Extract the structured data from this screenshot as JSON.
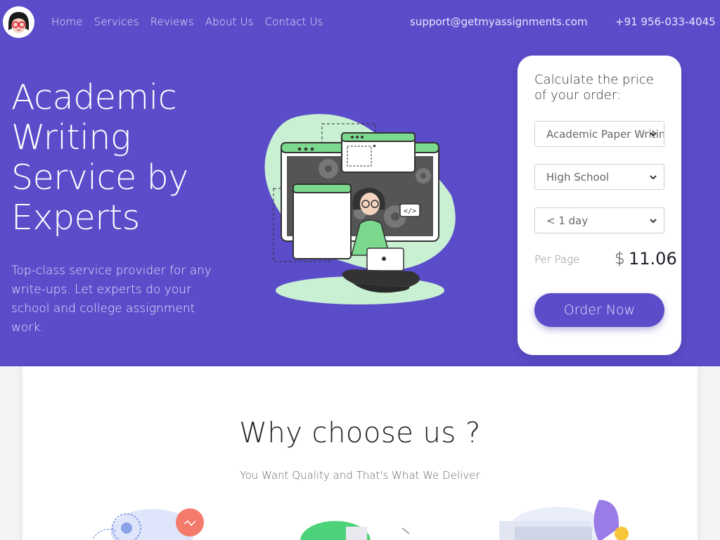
{
  "nav": {
    "items": [
      {
        "label": "Home"
      },
      {
        "label": "Services"
      },
      {
        "label": "Reviews"
      },
      {
        "label": "About Us"
      },
      {
        "label": "Contact Us"
      }
    ],
    "email": "support@getmyassignments.com",
    "phone": "+91 956-033-4045"
  },
  "hero": {
    "title": "Academic Writing Service by Experts",
    "subtitle": "Top-class service provider for any write-ups. Let experts do your school and college assignment work."
  },
  "calculator": {
    "title": "Calculate the price of your order:",
    "paper_type": "Academic Paper Writing",
    "academic_level": "High School",
    "deadline": "< 1 day",
    "per_page_label": "Per Page",
    "currency": "$",
    "price": "11.06",
    "order_button": "Order Now"
  },
  "why": {
    "title": "Why choose us ?",
    "subtitle": "You Want Quality and That's What We Deliver"
  },
  "colors": {
    "brand": "#5b4cc9",
    "card": "#ffffff",
    "accent_green": "#c9f0d3"
  }
}
